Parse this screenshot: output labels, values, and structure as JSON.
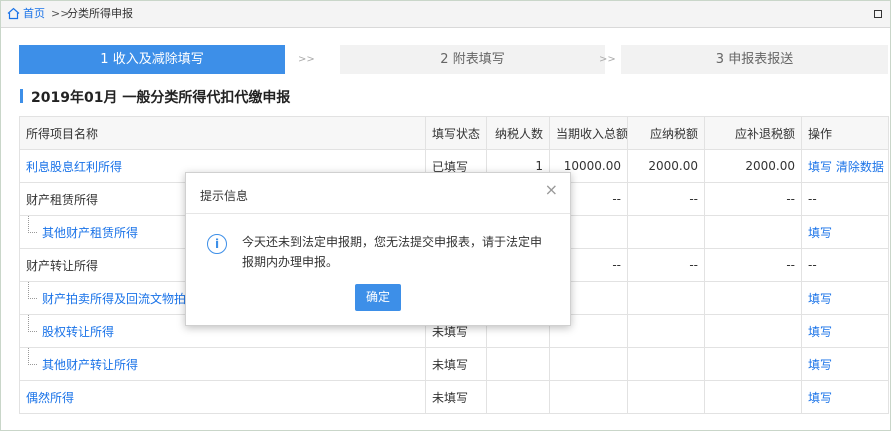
{
  "breadcrumb": {
    "home": "首页",
    "separator": ">>",
    "current": "分类所得申报"
  },
  "steps": [
    {
      "label": "1 收入及减除填写"
    },
    {
      "label": "2 附表填写"
    },
    {
      "label": "3 申报表报送"
    }
  ],
  "step_arrow": ">>",
  "page_title": "2019年01月 一般分类所得代扣代缴申报",
  "table": {
    "headers": [
      "所得项目名称",
      "填写状态",
      "纳税人数",
      "当期收入总额",
      "应纳税额",
      "应补退税额",
      "操作"
    ],
    "rows": [
      {
        "name": "利息股息红利所得",
        "status": "已填写",
        "count": "1",
        "income": "10000.00",
        "tax": "2000.00",
        "refund": "2000.00",
        "op1": "填写",
        "op2": "清除数据"
      },
      {
        "name": "财产租赁所得",
        "status": "",
        "count": "",
        "income": "--",
        "tax": "--",
        "refund": "--",
        "op1": "--",
        "op2": ""
      },
      {
        "name": "其他财产租赁所得",
        "status": "",
        "count": "",
        "income": "",
        "tax": "",
        "refund": "",
        "op1": "填写",
        "op2": ""
      },
      {
        "name": "财产转让所得",
        "status": "",
        "count": "",
        "income": "--",
        "tax": "--",
        "refund": "--",
        "op1": "--",
        "op2": ""
      },
      {
        "name": "财产拍卖所得及回流文物拍卖所得",
        "status": "",
        "count": "",
        "income": "",
        "tax": "",
        "refund": "",
        "op1": "填写",
        "op2": ""
      },
      {
        "name": "股权转让所得",
        "status": "未填写",
        "count": "",
        "income": "",
        "tax": "",
        "refund": "",
        "op1": "填写",
        "op2": ""
      },
      {
        "name": "其他财产转让所得",
        "status": "未填写",
        "count": "",
        "income": "",
        "tax": "",
        "refund": "",
        "op1": "填写",
        "op2": ""
      },
      {
        "name": "偶然所得",
        "status": "未填写",
        "count": "",
        "income": "",
        "tax": "",
        "refund": "",
        "op1": "填写",
        "op2": ""
      }
    ]
  },
  "dialog": {
    "title": "提示信息",
    "close": "×",
    "icon": "info-icon",
    "message": "今天还未到法定申报期，您无法提交申报表，请于法定申报期内办理申报。",
    "confirm": "确定"
  },
  "colors": {
    "accent": "#3d8fe8",
    "link": "#1a73e8"
  }
}
